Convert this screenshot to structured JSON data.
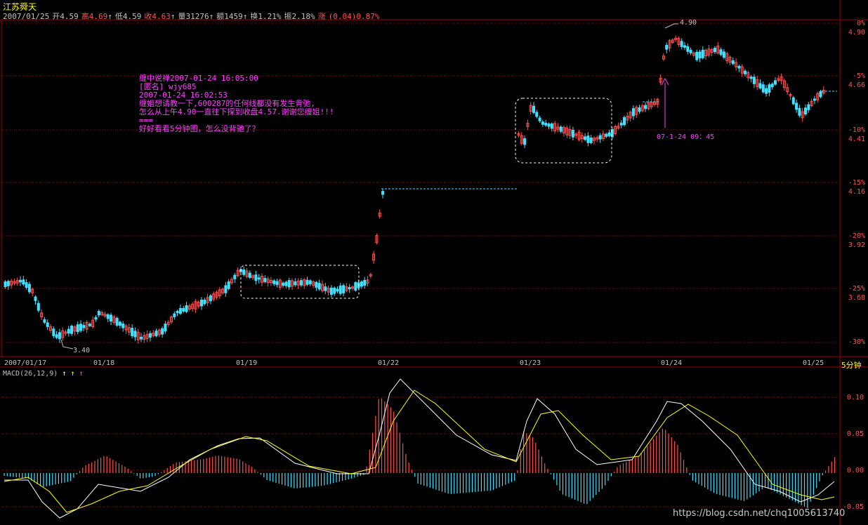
{
  "stock": {
    "name": "江苏舜天"
  },
  "quote": {
    "date": "2007/01/25",
    "open_label": "开",
    "open": "4.59",
    "high_label": "高",
    "high": "4.69",
    "low_label": "低",
    "low": "4.59",
    "close_label": "收",
    "close": "4.63",
    "vol_label": "量",
    "vol": "31276",
    "amt_label": "额",
    "amt": "1459",
    "turn_label": "换",
    "turn": "1.21%",
    "amp_label": "振",
    "amp": "2.18%",
    "chg_label": "涨",
    "chg": "(0.04)",
    "chg_pct": "0.87%"
  },
  "price_axis": {
    "pct_labels": [
      "0%",
      "-5%",
      "-10%",
      "-15%",
      "-20%",
      "-25%",
      "-30%"
    ],
    "price_labels": [
      "4.90",
      "4.66",
      "4.41",
      "4.16",
      "3.92",
      "3.68"
    ]
  },
  "date_axis": {
    "dates": [
      "2007/01/17",
      "01/18",
      "01/19",
      "01/22",
      "01/23",
      "01/24",
      "01/25"
    ],
    "period": "5分钟"
  },
  "macd": {
    "title": "MACD(26,12,9)",
    "arrows": [
      "↑",
      "↑",
      "↑"
    ],
    "axis_labels": [
      "0.10",
      "0.05",
      "0.00",
      "-0.05"
    ]
  },
  "annotations": {
    "comment_lines": [
      "缠中说禅2007-01-24 16:05:00",
      "[匿名] wjy685",
      "",
      "2007-01-24 16:02:53",
      "缠姐想请教一下,600287的任何线都没有发生背弛,",
      "怎么从上午4.90一直往下探到收盘4.57.谢谢您缠姐!!!",
      "",
      "===",
      "好好看看5分钟图，怎么没背驰了？"
    ],
    "arrow_time": "07-1-24  09：45",
    "low_label": "3.40",
    "high_label": "4.90"
  },
  "watermark": "https://blog.csdn.net/chq1005613740",
  "colors": {
    "up": "#ff5050",
    "down": "#40e0ff",
    "grid": "#a00000",
    "dif": "#ffffff",
    "dea": "#ffff00",
    "note": "#ff40ff"
  }
}
